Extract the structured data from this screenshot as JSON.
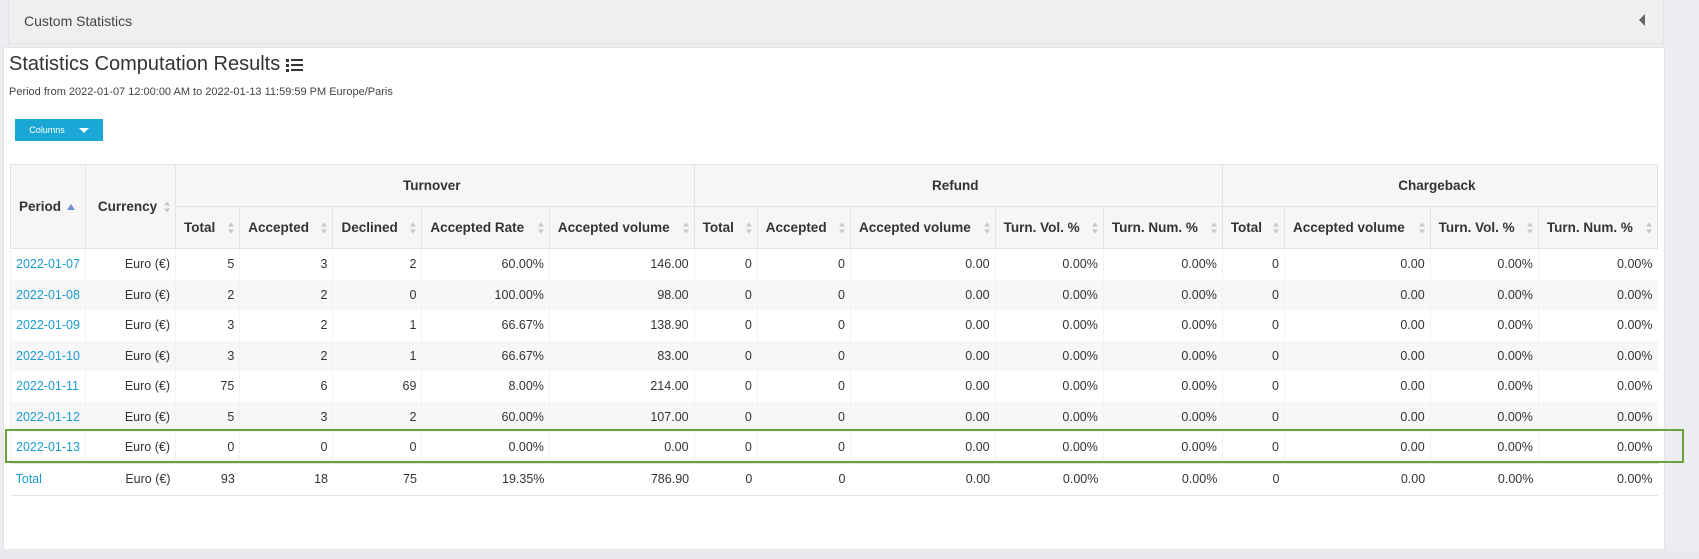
{
  "custom_statistics": {
    "title": "Custom Statistics"
  },
  "results": {
    "title": "Statistics Computation Results",
    "period_text": "Period from 2022-01-07 12:00:00 AM to 2022-01-13 11:59:59 PM Europe/Paris",
    "columns_button": "Columns"
  },
  "table": {
    "headers": {
      "period": "Period",
      "currency": "Currency",
      "turnover": "Turnover",
      "refund": "Refund",
      "chargeback": "Chargeback",
      "t_total": "Total",
      "t_accepted": "Accepted",
      "t_declined": "Declined",
      "t_accepted_rate": "Accepted Rate",
      "t_accepted_volume": "Accepted volume",
      "r_total": "Total",
      "r_accepted": "Accepted",
      "r_accepted_volume": "Accepted volume",
      "r_turn_vol": "Turn. Vol. %",
      "r_turn_num": "Turn. Num. %",
      "c_total": "Total",
      "c_accepted_volume": "Accepted volume",
      "c_turn_vol": "Turn. Vol. %",
      "c_turn_num": "Turn. Num. %"
    },
    "rows": [
      [
        "2022-01-07",
        "Euro (€)",
        "5",
        "3",
        "2",
        "60.00%",
        "146.00",
        "0",
        "0",
        "0.00",
        "0.00%",
        "0.00%",
        "0",
        "0.00",
        "0.00%",
        "0.00%"
      ],
      [
        "2022-01-08",
        "Euro (€)",
        "2",
        "2",
        "0",
        "100.00%",
        "98.00",
        "0",
        "0",
        "0.00",
        "0.00%",
        "0.00%",
        "0",
        "0.00",
        "0.00%",
        "0.00%"
      ],
      [
        "2022-01-09",
        "Euro (€)",
        "3",
        "2",
        "1",
        "66.67%",
        "138.90",
        "0",
        "0",
        "0.00",
        "0.00%",
        "0.00%",
        "0",
        "0.00",
        "0.00%",
        "0.00%"
      ],
      [
        "2022-01-10",
        "Euro (€)",
        "3",
        "2",
        "1",
        "66.67%",
        "83.00",
        "0",
        "0",
        "0.00",
        "0.00%",
        "0.00%",
        "0",
        "0.00",
        "0.00%",
        "0.00%"
      ],
      [
        "2022-01-11",
        "Euro (€)",
        "75",
        "6",
        "69",
        "8.00%",
        "214.00",
        "0",
        "0",
        "0.00",
        "0.00%",
        "0.00%",
        "0",
        "0.00",
        "0.00%",
        "0.00%"
      ],
      [
        "2022-01-12",
        "Euro (€)",
        "5",
        "3",
        "2",
        "60.00%",
        "107.00",
        "0",
        "0",
        "0.00",
        "0.00%",
        "0.00%",
        "0",
        "0.00",
        "0.00%",
        "0.00%"
      ],
      [
        "2022-01-13",
        "Euro (€)",
        "0",
        "0",
        "0",
        "0.00%",
        "0.00",
        "0",
        "0",
        "0.00",
        "0.00%",
        "0.00%",
        "0",
        "0.00",
        "0.00%",
        "0.00%"
      ]
    ],
    "total": [
      "Total",
      "Euro (€)",
      "93",
      "18",
      "75",
      "19.35%",
      "786.90",
      "0",
      "0",
      "0.00",
      "0.00%",
      "0.00%",
      "0",
      "0.00",
      "0.00%",
      "0.00%"
    ]
  },
  "highlight_color": "#67a33a",
  "link_color": "#1a9ccf",
  "button_color": "#1ba8d6"
}
